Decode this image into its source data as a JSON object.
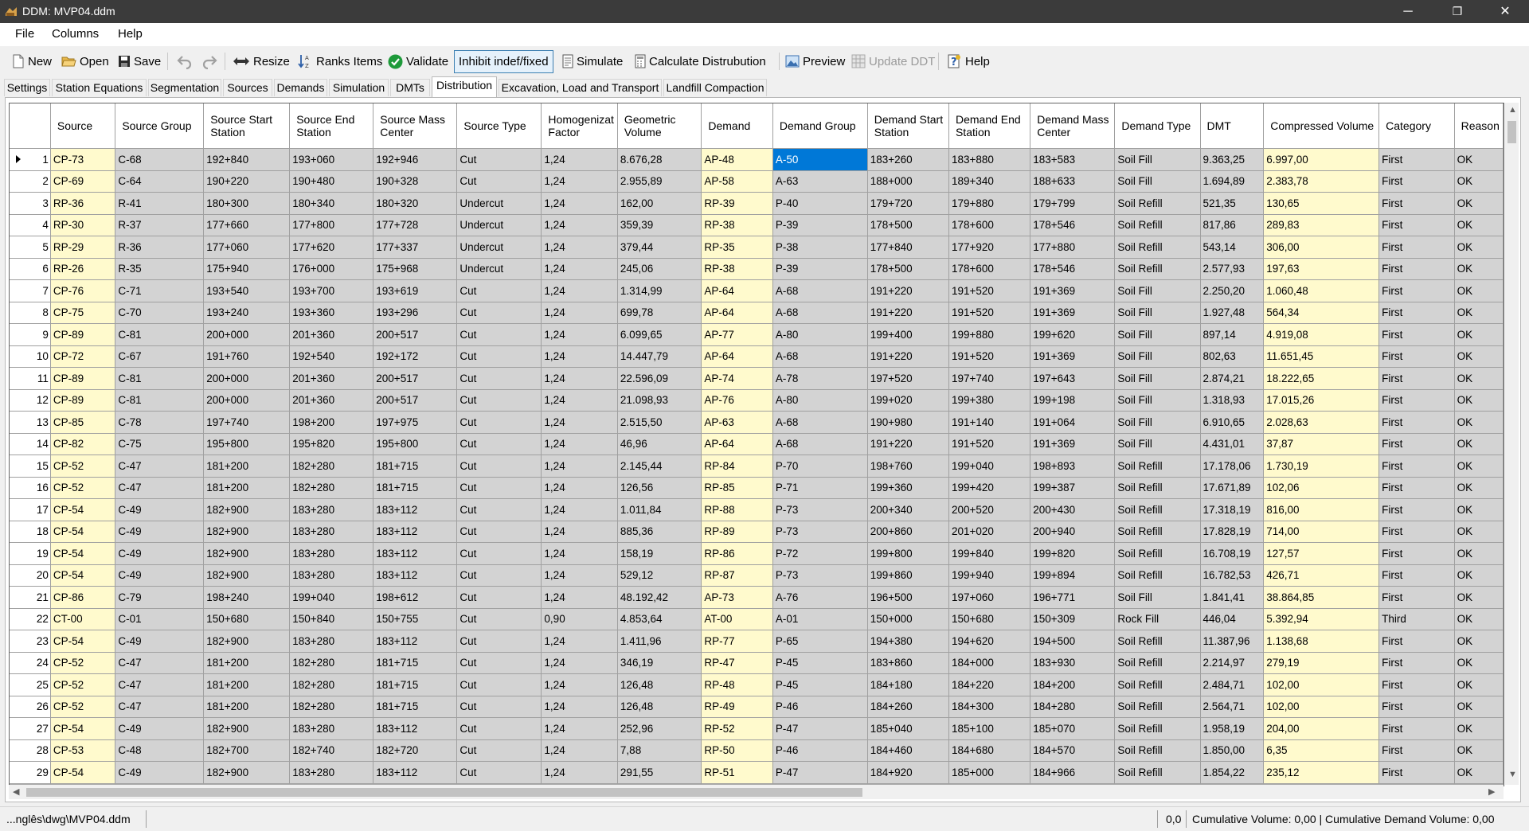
{
  "window": {
    "title": "DDM: MVP04.ddm",
    "minimize_glyph": "─",
    "restore_glyph": "❐",
    "close_glyph": "✕"
  },
  "menu": [
    "File",
    "Columns",
    "Help"
  ],
  "toolbar": {
    "new": "New",
    "open": "Open",
    "save": "Save",
    "resize": "Resize",
    "ranks_items": "Ranks Items",
    "validate": "Validate",
    "inhibit": "Inhibit indef/fixed",
    "simulate": "Simulate",
    "calculate": "Calculate Distrubution",
    "preview": "Preview",
    "update_ddt": "Update DDT",
    "help": "Help"
  },
  "tabs": [
    "Settings",
    "Station Equations",
    "Segmentation",
    "Sources",
    "Demands",
    "Simulation",
    "DMTs",
    "Distribution",
    "Excavation, Load and Transport",
    "Landfill Compaction"
  ],
  "active_tab": "Distribution",
  "grid": {
    "columns": [
      "Source",
      "Source Group",
      "Source Start Station",
      "Source End Station",
      "Source Mass Center",
      "Source Type",
      "Homogenizat Factor",
      "Geometric Volume",
      "Demand",
      "Demand Group",
      "Demand Start Station",
      "Demand End Station",
      "Demand Mass Center",
      "Demand Type",
      "DMT",
      "Compressed Volume",
      "Category",
      "Reason"
    ],
    "rows": [
      [
        "1",
        "CP-73",
        "C-68",
        "192+840",
        "193+060",
        "192+946",
        "Cut",
        "1,24",
        "8.676,28",
        "AP-48",
        "A-50",
        "183+260",
        "183+880",
        "183+583",
        "Soil Fill",
        "9.363,25",
        "6.997,00",
        "First",
        "OK"
      ],
      [
        "2",
        "CP-69",
        "C-64",
        "190+220",
        "190+480",
        "190+328",
        "Cut",
        "1,24",
        "2.955,89",
        "AP-58",
        "A-63",
        "188+000",
        "189+340",
        "188+633",
        "Soil Fill",
        "1.694,89",
        "2.383,78",
        "First",
        "OK"
      ],
      [
        "3",
        "RP-36",
        "R-41",
        "180+300",
        "180+340",
        "180+320",
        "Undercut",
        "1,24",
        "162,00",
        "RP-39",
        "P-40",
        "179+720",
        "179+880",
        "179+799",
        "Soil Refill",
        "521,35",
        "130,65",
        "First",
        "OK"
      ],
      [
        "4",
        "RP-30",
        "R-37",
        "177+660",
        "177+800",
        "177+728",
        "Undercut",
        "1,24",
        "359,39",
        "RP-38",
        "P-39",
        "178+500",
        "178+600",
        "178+546",
        "Soil Refill",
        "817,86",
        "289,83",
        "First",
        "OK"
      ],
      [
        "5",
        "RP-29",
        "R-36",
        "177+060",
        "177+620",
        "177+337",
        "Undercut",
        "1,24",
        "379,44",
        "RP-35",
        "P-38",
        "177+840",
        "177+920",
        "177+880",
        "Soil Refill",
        "543,14",
        "306,00",
        "First",
        "OK"
      ],
      [
        "6",
        "RP-26",
        "R-35",
        "175+940",
        "176+000",
        "175+968",
        "Undercut",
        "1,24",
        "245,06",
        "RP-38",
        "P-39",
        "178+500",
        "178+600",
        "178+546",
        "Soil Refill",
        "2.577,93",
        "197,63",
        "First",
        "OK"
      ],
      [
        "7",
        "CP-76",
        "C-71",
        "193+540",
        "193+700",
        "193+619",
        "Cut",
        "1,24",
        "1.314,99",
        "AP-64",
        "A-68",
        "191+220",
        "191+520",
        "191+369",
        "Soil Fill",
        "2.250,20",
        "1.060,48",
        "First",
        "OK"
      ],
      [
        "8",
        "CP-75",
        "C-70",
        "193+240",
        "193+360",
        "193+296",
        "Cut",
        "1,24",
        "699,78",
        "AP-64",
        "A-68",
        "191+220",
        "191+520",
        "191+369",
        "Soil Fill",
        "1.927,48",
        "564,34",
        "First",
        "OK"
      ],
      [
        "9",
        "CP-89",
        "C-81",
        "200+000",
        "201+360",
        "200+517",
        "Cut",
        "1,24",
        "6.099,65",
        "AP-77",
        "A-80",
        "199+400",
        "199+880",
        "199+620",
        "Soil Fill",
        "897,14",
        "4.919,08",
        "First",
        "OK"
      ],
      [
        "10",
        "CP-72",
        "C-67",
        "191+760",
        "192+540",
        "192+172",
        "Cut",
        "1,24",
        "14.447,79",
        "AP-64",
        "A-68",
        "191+220",
        "191+520",
        "191+369",
        "Soil Fill",
        "802,63",
        "11.651,45",
        "First",
        "OK"
      ],
      [
        "11",
        "CP-89",
        "C-81",
        "200+000",
        "201+360",
        "200+517",
        "Cut",
        "1,24",
        "22.596,09",
        "AP-74",
        "A-78",
        "197+520",
        "197+740",
        "197+643",
        "Soil Fill",
        "2.874,21",
        "18.222,65",
        "First",
        "OK"
      ],
      [
        "12",
        "CP-89",
        "C-81",
        "200+000",
        "201+360",
        "200+517",
        "Cut",
        "1,24",
        "21.098,93",
        "AP-76",
        "A-80",
        "199+020",
        "199+380",
        "199+198",
        "Soil Fill",
        "1.318,93",
        "17.015,26",
        "First",
        "OK"
      ],
      [
        "13",
        "CP-85",
        "C-78",
        "197+740",
        "198+200",
        "197+975",
        "Cut",
        "1,24",
        "2.515,50",
        "AP-63",
        "A-68",
        "190+980",
        "191+140",
        "191+064",
        "Soil Fill",
        "6.910,65",
        "2.028,63",
        "First",
        "OK"
      ],
      [
        "14",
        "CP-82",
        "C-75",
        "195+800",
        "195+820",
        "195+800",
        "Cut",
        "1,24",
        "46,96",
        "AP-64",
        "A-68",
        "191+220",
        "191+520",
        "191+369",
        "Soil Fill",
        "4.431,01",
        "37,87",
        "First",
        "OK"
      ],
      [
        "15",
        "CP-52",
        "C-47",
        "181+200",
        "182+280",
        "181+715",
        "Cut",
        "1,24",
        "2.145,44",
        "RP-84",
        "P-70",
        "198+760",
        "199+040",
        "198+893",
        "Soil Refill",
        "17.178,06",
        "1.730,19",
        "First",
        "OK"
      ],
      [
        "16",
        "CP-52",
        "C-47",
        "181+200",
        "182+280",
        "181+715",
        "Cut",
        "1,24",
        "126,56",
        "RP-85",
        "P-71",
        "199+360",
        "199+420",
        "199+387",
        "Soil Refill",
        "17.671,89",
        "102,06",
        "First",
        "OK"
      ],
      [
        "17",
        "CP-54",
        "C-49",
        "182+900",
        "183+280",
        "183+112",
        "Cut",
        "1,24",
        "1.011,84",
        "RP-88",
        "P-73",
        "200+340",
        "200+520",
        "200+430",
        "Soil Refill",
        "17.318,19",
        "816,00",
        "First",
        "OK"
      ],
      [
        "18",
        "CP-54",
        "C-49",
        "182+900",
        "183+280",
        "183+112",
        "Cut",
        "1,24",
        "885,36",
        "RP-89",
        "P-73",
        "200+860",
        "201+020",
        "200+940",
        "Soil Refill",
        "17.828,19",
        "714,00",
        "First",
        "OK"
      ],
      [
        "19",
        "CP-54",
        "C-49",
        "182+900",
        "183+280",
        "183+112",
        "Cut",
        "1,24",
        "158,19",
        "RP-86",
        "P-72",
        "199+800",
        "199+840",
        "199+820",
        "Soil Refill",
        "16.708,19",
        "127,57",
        "First",
        "OK"
      ],
      [
        "20",
        "CP-54",
        "C-49",
        "182+900",
        "183+280",
        "183+112",
        "Cut",
        "1,24",
        "529,12",
        "RP-87",
        "P-73",
        "199+860",
        "199+940",
        "199+894",
        "Soil Refill",
        "16.782,53",
        "426,71",
        "First",
        "OK"
      ],
      [
        "21",
        "CP-86",
        "C-79",
        "198+240",
        "199+040",
        "198+612",
        "Cut",
        "1,24",
        "48.192,42",
        "AP-73",
        "A-76",
        "196+500",
        "197+060",
        "196+771",
        "Soil Fill",
        "1.841,41",
        "38.864,85",
        "First",
        "OK"
      ],
      [
        "22",
        "CT-00",
        "C-01",
        "150+680",
        "150+840",
        "150+755",
        "Cut",
        "0,90",
        "4.853,64",
        "AT-00",
        "A-01",
        "150+000",
        "150+680",
        "150+309",
        "Rock Fill",
        "446,04",
        "5.392,94",
        "Third",
        "OK"
      ],
      [
        "23",
        "CP-54",
        "C-49",
        "182+900",
        "183+280",
        "183+112",
        "Cut",
        "1,24",
        "1.411,96",
        "RP-77",
        "P-65",
        "194+380",
        "194+620",
        "194+500",
        "Soil Refill",
        "11.387,96",
        "1.138,68",
        "First",
        "OK"
      ],
      [
        "24",
        "CP-52",
        "C-47",
        "181+200",
        "182+280",
        "181+715",
        "Cut",
        "1,24",
        "346,19",
        "RP-47",
        "P-45",
        "183+860",
        "184+000",
        "183+930",
        "Soil Refill",
        "2.214,97",
        "279,19",
        "First",
        "OK"
      ],
      [
        "25",
        "CP-52",
        "C-47",
        "181+200",
        "182+280",
        "181+715",
        "Cut",
        "1,24",
        "126,48",
        "RP-48",
        "P-45",
        "184+180",
        "184+220",
        "184+200",
        "Soil Refill",
        "2.484,71",
        "102,00",
        "First",
        "OK"
      ],
      [
        "26",
        "CP-52",
        "C-47",
        "181+200",
        "182+280",
        "181+715",
        "Cut",
        "1,24",
        "126,48",
        "RP-49",
        "P-46",
        "184+260",
        "184+300",
        "184+280",
        "Soil Refill",
        "2.564,71",
        "102,00",
        "First",
        "OK"
      ],
      [
        "27",
        "CP-54",
        "C-49",
        "182+900",
        "183+280",
        "183+112",
        "Cut",
        "1,24",
        "252,96",
        "RP-52",
        "P-47",
        "185+040",
        "185+100",
        "185+070",
        "Soil Refill",
        "1.958,19",
        "204,00",
        "First",
        "OK"
      ],
      [
        "28",
        "CP-53",
        "C-48",
        "182+700",
        "182+740",
        "182+720",
        "Cut",
        "1,24",
        "7,88",
        "RP-50",
        "P-46",
        "184+460",
        "184+680",
        "184+570",
        "Soil Refill",
        "1.850,00",
        "6,35",
        "First",
        "OK"
      ],
      [
        "29",
        "CP-54",
        "C-49",
        "182+900",
        "183+280",
        "183+112",
        "Cut",
        "1,24",
        "291,55",
        "RP-51",
        "P-47",
        "184+920",
        "185+000",
        "184+966",
        "Soil Refill",
        "1.854,22",
        "235,12",
        "First",
        "OK"
      ]
    ],
    "selected_cell": {
      "row": 1,
      "column": "Demand Group"
    }
  },
  "status": {
    "path": "...nglês\\dwg\\MVP04.ddm",
    "coord": "0,0",
    "cumulative": "Cumulative Volume: 0,00 | Cumulative Demand Volume: 0,00"
  },
  "colors": {
    "titlebar": "#3b3b3b",
    "cell": "#d3d3d3",
    "highlight_cell": "#fffacd",
    "selection": "#0078d7"
  }
}
